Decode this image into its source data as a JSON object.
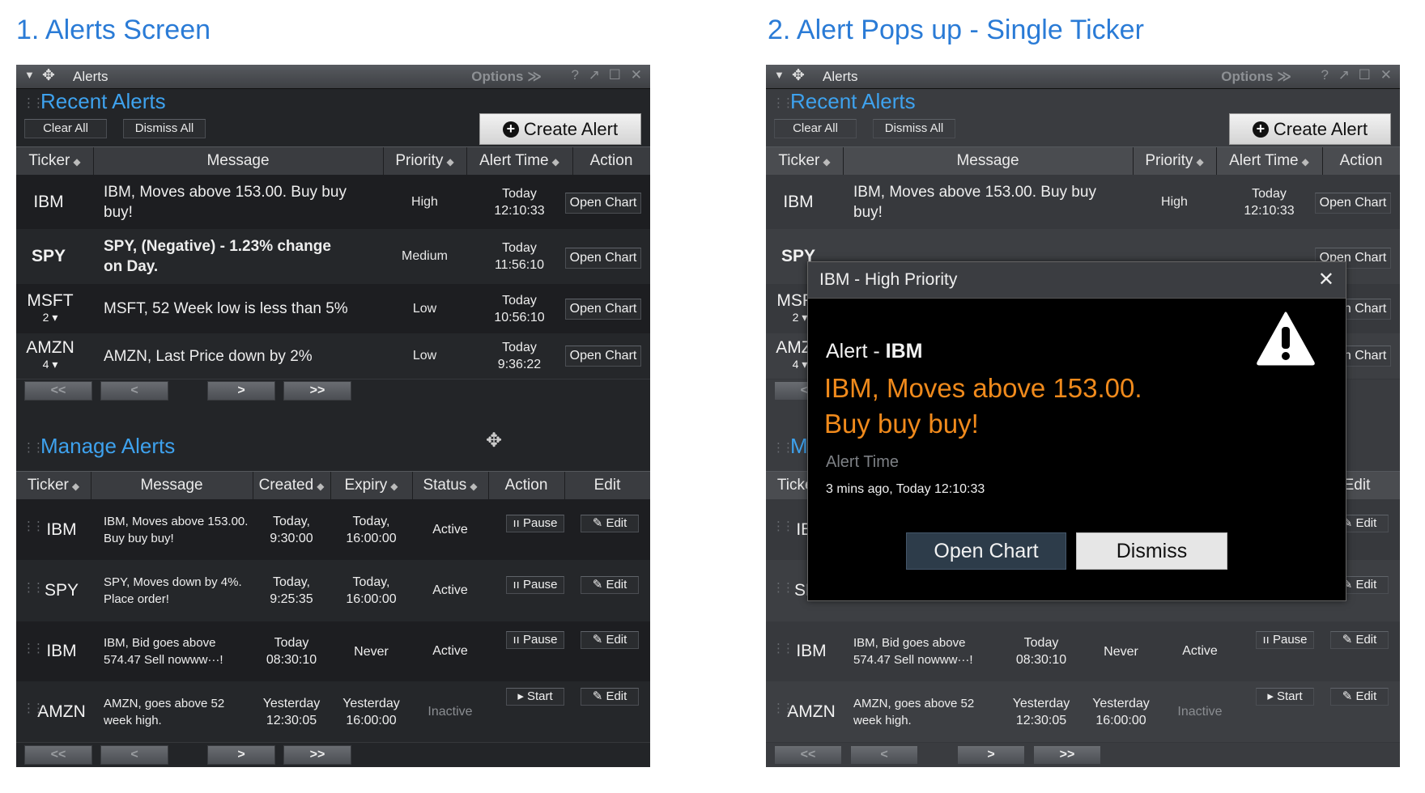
{
  "headings": {
    "left": "1. Alerts Screen",
    "right": "2. Alert Pops up - Single Ticker"
  },
  "window": {
    "title": "Alerts",
    "options_label": "Options ≫"
  },
  "recent": {
    "title": "Recent Alerts",
    "clear_all": "Clear All",
    "dismiss_all": "Dismiss All",
    "create_alert": "Create Alert",
    "columns": [
      "Ticker",
      "Message",
      "Priority",
      "Alert Time",
      "Action"
    ],
    "rows": [
      {
        "ticker": "IBM",
        "sub": "",
        "message": "IBM, Moves above 153.00. Buy buy buy!",
        "bold": false,
        "priority": "High",
        "date": "Today",
        "time": "12:10:33",
        "action": "Open Chart"
      },
      {
        "ticker": "SPY",
        "sub": "",
        "message": "SPY, (Negative) - 1.23% change on Day.",
        "bold": true,
        "priority": "Medium",
        "date": "Today",
        "time": "11:56:10",
        "action": "Open Chart"
      },
      {
        "ticker": "MSFT",
        "sub": "2 ▾",
        "message": "MSFT, 52 Week low is less than 5%",
        "bold": false,
        "priority": "Low",
        "date": "Today",
        "time": "10:56:10",
        "action": "Open Chart"
      },
      {
        "ticker": "AMZN",
        "sub": "4 ▾",
        "message": "AMZN, Last Price down by 2%",
        "bold": false,
        "priority": "Low",
        "date": "Today",
        "time": "9:36:22",
        "action": "Open Chart"
      }
    ]
  },
  "pager": {
    "first": "<<",
    "prev": "<",
    "next": ">",
    "last": ">>"
  },
  "manage": {
    "title": "Manage Alerts",
    "columns": [
      "Ticker",
      "Message",
      "Created",
      "Expiry",
      "Status",
      "Action",
      "Edit"
    ],
    "rows": [
      {
        "ticker": "IBM",
        "message": "IBM, Moves above 153.00. Buy buy buy!",
        "created_a": "Today,",
        "created_b": "9:30:00",
        "expiry_a": "Today,",
        "expiry_b": "16:00:00",
        "status": "Active",
        "action": "ıı Pause",
        "edit": "✎ Edit"
      },
      {
        "ticker": "SPY",
        "message": "SPY, Moves down by 4%. Place order!",
        "created_a": "Today,",
        "created_b": "9:25:35",
        "expiry_a": "Today,",
        "expiry_b": "16:00:00",
        "status": "Active",
        "action": "ıı Pause",
        "edit": "✎ Edit"
      },
      {
        "ticker": "IBM",
        "message": "IBM, Bid goes above 574.47 Sell nowww···!",
        "created_a": "Today",
        "created_b": "08:30:10",
        "expiry_a": "Never",
        "expiry_b": "",
        "status": "Active",
        "action": "ıı Pause",
        "edit": "✎ Edit"
      },
      {
        "ticker": "AMZN",
        "message": "AMZN, goes above 52 week high.",
        "created_a": "Yesterday",
        "created_b": "12:30:05",
        "expiry_a": "Yesterday",
        "expiry_b": "16:00:00",
        "status": "Inactive",
        "action": "▸ Start",
        "edit": "✎ Edit"
      }
    ]
  },
  "modal": {
    "title": "IBM - High Priority",
    "alert_prefix": "Alert - ",
    "alert_ticker": "IBM",
    "message": "IBM, Moves above 153.00. Buy buy buy!",
    "time_label": "Alert Time",
    "time_value": "3 mins ago, Today 12:10:33",
    "open_chart": "Open Chart",
    "dismiss": "Dismiss"
  },
  "colors": {
    "accent_blue": "#3ea2ee",
    "heading_blue": "#2a7bd6",
    "alert_orange": "#f08a1c",
    "panel_bg": "#232528"
  }
}
